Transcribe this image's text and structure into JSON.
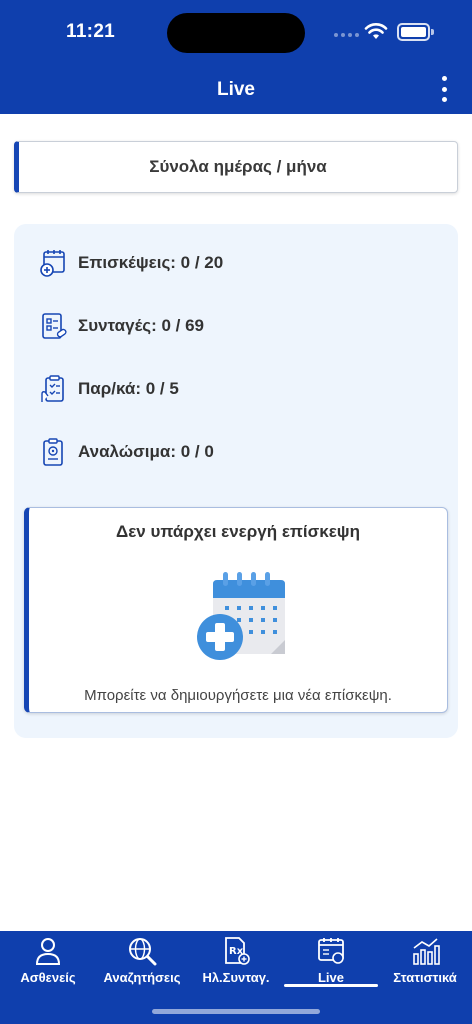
{
  "status_bar": {
    "time": "11:21"
  },
  "header": {
    "title": "Live"
  },
  "totals_button": {
    "label": "Σύνολα ημέρας / μήνα"
  },
  "stats": [
    {
      "label": "Επισκέψεις: 0 / 20",
      "icon": "calendar-plus-icon"
    },
    {
      "label": "Συνταγές: 0 / 69",
      "icon": "prescription-icon"
    },
    {
      "label": "Παρ/κά: 0 / 5",
      "icon": "clipboard-hand-icon"
    },
    {
      "label": "Αναλώσιμα: 0 / 0",
      "icon": "clipboard-badge-icon"
    }
  ],
  "visit_card": {
    "title": "Δεν υπάρχει ενεργή επίσκεψη",
    "subtitle": "Μπορείτε να δημιουργήσετε μια νέα επίσκεψη."
  },
  "tabs": [
    {
      "label": "Ασθενείς",
      "icon": "person-icon",
      "active": false
    },
    {
      "label": "Αναζητήσεις",
      "icon": "search-globe-icon",
      "active": false
    },
    {
      "label": "Ηλ.Συνταγ.",
      "icon": "e-prescription-icon",
      "active": false
    },
    {
      "label": "Live",
      "icon": "calendar-live-icon",
      "active": true
    },
    {
      "label": "Στατιστικά",
      "icon": "bar-chart-icon",
      "active": false
    }
  ],
  "colors": {
    "primary": "#0f3fad",
    "accent": "#1646b4",
    "card_bg": "#eef5fd",
    "illustration_blue": "#3f8fdc"
  }
}
